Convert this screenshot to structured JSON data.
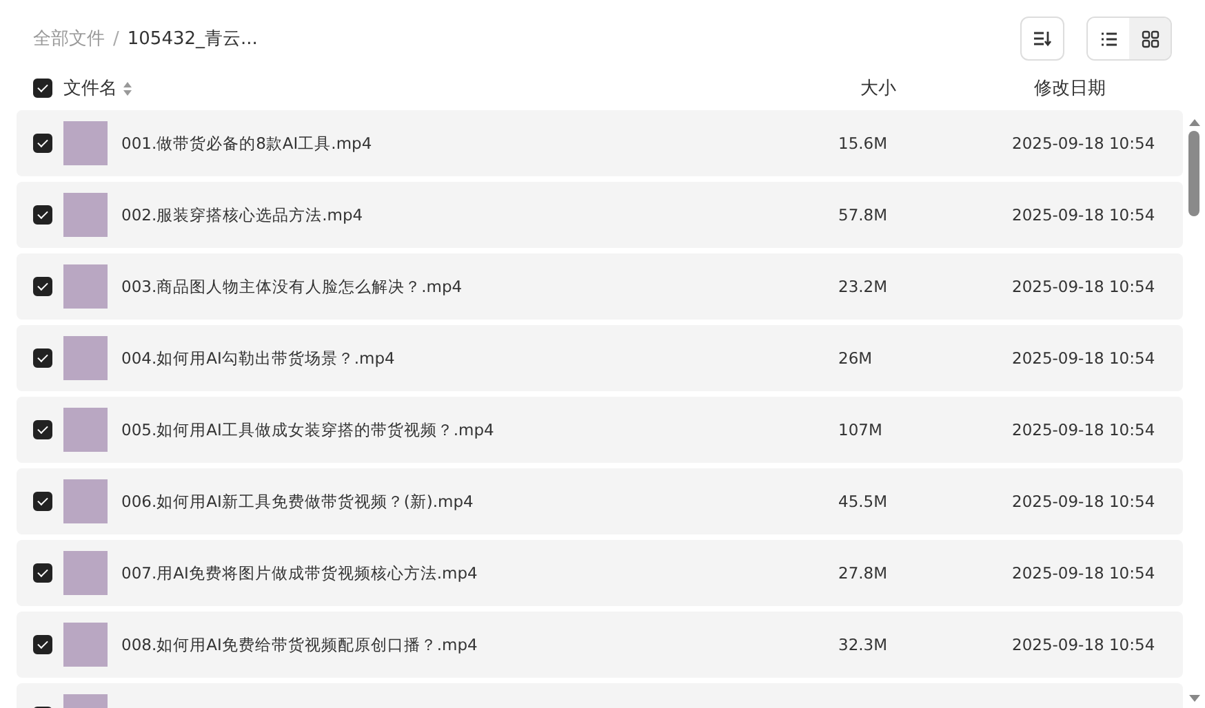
{
  "breadcrumb_separator": "/",
  "breadcrumb": [
    {
      "label": "全部文件",
      "current": false
    },
    {
      "label": "105432_青云...",
      "current": true
    }
  ],
  "view_modes": [
    {
      "kind": "list",
      "selected": false
    },
    {
      "kind": "grid",
      "selected": true
    }
  ],
  "header": {
    "checked": true,
    "name": "文件名",
    "size": "大小",
    "date": "修改日期"
  },
  "rows": [
    {
      "checked": true,
      "name": "001.做带货必备的8款AI工具.mp4",
      "size": "15.6M",
      "date": "2025-09-18 10:54"
    },
    {
      "checked": true,
      "name": "002.服装穿搭核心选品方法.mp4",
      "size": "57.8M",
      "date": "2025-09-18 10:54"
    },
    {
      "checked": true,
      "name": "003.商品图人物主体没有人脸怎么解决？.mp4",
      "size": "23.2M",
      "date": "2025-09-18 10:54"
    },
    {
      "checked": true,
      "name": "004.如何用AI勾勒出带货场景？.mp4",
      "size": "26M",
      "date": "2025-09-18 10:54"
    },
    {
      "checked": true,
      "name": "005.如何用AI工具做成女装穿搭的带货视频？.mp4",
      "size": "107M",
      "date": "2025-09-18 10:54"
    },
    {
      "checked": true,
      "name": "006.如何用AI新工具免费做带货视频？(新).mp4",
      "size": "45.5M",
      "date": "2025-09-18 10:54"
    },
    {
      "checked": true,
      "name": "007.用AI免费将图片做成带货视频核心方法.mp4",
      "size": "27.8M",
      "date": "2025-09-18 10:54"
    },
    {
      "checked": true,
      "name": "008.如何用AI免费给带货视频配原创口播？.mp4",
      "size": "32.3M",
      "date": "2025-09-18 10:54"
    },
    {
      "checked": true
    }
  ]
}
